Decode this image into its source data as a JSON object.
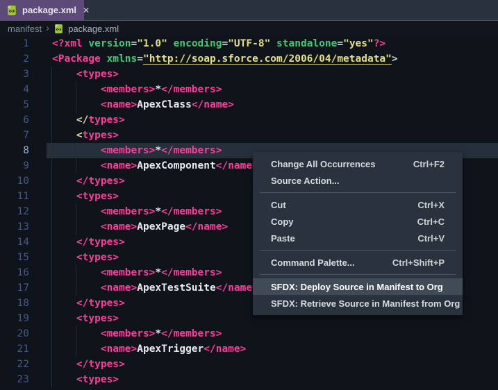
{
  "tab_bar": {
    "active_tab": {
      "label": "package.xml",
      "close_glyph": "✕"
    }
  },
  "breadcrumb": {
    "items": [
      "manifest",
      "package.xml"
    ],
    "separator": "›"
  },
  "editor": {
    "language": "xml",
    "active_line": 8,
    "lines": [
      {
        "n": 1,
        "tokens": [
          {
            "t": "tag",
            "s": "<?xml"
          },
          {
            "t": "plain",
            "s": " "
          },
          {
            "t": "attr",
            "s": "version"
          },
          {
            "t": "punc",
            "s": "="
          },
          {
            "t": "str",
            "s": "\"1.0\""
          },
          {
            "t": "plain",
            "s": " "
          },
          {
            "t": "attr",
            "s": "encoding"
          },
          {
            "t": "punc",
            "s": "="
          },
          {
            "t": "str",
            "s": "\"UTF-8\""
          },
          {
            "t": "plain",
            "s": " "
          },
          {
            "t": "attr",
            "s": "standalone"
          },
          {
            "t": "punc",
            "s": "="
          },
          {
            "t": "str",
            "s": "\"yes\""
          },
          {
            "t": "tag",
            "s": "?>"
          }
        ]
      },
      {
        "n": 2,
        "tokens": [
          {
            "t": "tag",
            "s": "<Package"
          },
          {
            "t": "plain",
            "s": " "
          },
          {
            "t": "attr",
            "s": "xmlns"
          },
          {
            "t": "punc",
            "s": "="
          },
          {
            "t": "link",
            "s": "\"http://soap.sforce.com/2006/04/metadata\""
          },
          {
            "t": "punc",
            "s": ">"
          }
        ]
      },
      {
        "n": 3,
        "tokens": [
          {
            "t": "ws",
            "s": "    "
          },
          {
            "t": "tag",
            "s": "<types>"
          }
        ]
      },
      {
        "n": 4,
        "tokens": [
          {
            "t": "ws",
            "s": "        "
          },
          {
            "t": "tag",
            "s": "<members>"
          },
          {
            "t": "plain",
            "s": "*"
          },
          {
            "t": "tag",
            "s": "</members>"
          }
        ]
      },
      {
        "n": 5,
        "tokens": [
          {
            "t": "ws",
            "s": "        "
          },
          {
            "t": "tag",
            "s": "<name>"
          },
          {
            "t": "plain",
            "s": "ApexClass"
          },
          {
            "t": "tag",
            "s": "</name>"
          }
        ]
      },
      {
        "n": 6,
        "tokens": [
          {
            "t": "ws",
            "s": "    "
          },
          {
            "t": "gold",
            "s": "</"
          },
          {
            "t": "tag",
            "s": "types>"
          }
        ]
      },
      {
        "n": 7,
        "tokens": [
          {
            "t": "ws",
            "s": "    "
          },
          {
            "t": "gold",
            "s": "<"
          },
          {
            "t": "tag",
            "s": "types>"
          }
        ]
      },
      {
        "n": 8,
        "tokens": [
          {
            "t": "ws",
            "s": "        "
          },
          {
            "t": "tag",
            "s": "<members>"
          },
          {
            "t": "plain",
            "s": "*"
          },
          {
            "t": "tag",
            "s": "</members>"
          }
        ]
      },
      {
        "n": 9,
        "tokens": [
          {
            "t": "ws",
            "s": "        "
          },
          {
            "t": "tag",
            "s": "<name>"
          },
          {
            "t": "plain",
            "s": "ApexComponent"
          },
          {
            "t": "tag",
            "s": "</name>"
          }
        ]
      },
      {
        "n": 10,
        "tokens": [
          {
            "t": "ws",
            "s": "    "
          },
          {
            "t": "tag",
            "s": "</types>"
          }
        ]
      },
      {
        "n": 11,
        "tokens": [
          {
            "t": "ws",
            "s": "    "
          },
          {
            "t": "tag",
            "s": "<types>"
          }
        ]
      },
      {
        "n": 12,
        "tokens": [
          {
            "t": "ws",
            "s": "        "
          },
          {
            "t": "tag",
            "s": "<members>"
          },
          {
            "t": "plain",
            "s": "*"
          },
          {
            "t": "tag",
            "s": "</members>"
          }
        ]
      },
      {
        "n": 13,
        "tokens": [
          {
            "t": "ws",
            "s": "        "
          },
          {
            "t": "tag",
            "s": "<name>"
          },
          {
            "t": "plain",
            "s": "ApexPage"
          },
          {
            "t": "tag",
            "s": "</name>"
          }
        ]
      },
      {
        "n": 14,
        "tokens": [
          {
            "t": "ws",
            "s": "    "
          },
          {
            "t": "tag",
            "s": "</types>"
          }
        ]
      },
      {
        "n": 15,
        "tokens": [
          {
            "t": "ws",
            "s": "    "
          },
          {
            "t": "tag",
            "s": "<types>"
          }
        ]
      },
      {
        "n": 16,
        "tokens": [
          {
            "t": "ws",
            "s": "        "
          },
          {
            "t": "tag",
            "s": "<members>"
          },
          {
            "t": "plain",
            "s": "*"
          },
          {
            "t": "tag",
            "s": "</members>"
          }
        ]
      },
      {
        "n": 17,
        "tokens": [
          {
            "t": "ws",
            "s": "        "
          },
          {
            "t": "tag",
            "s": "<name>"
          },
          {
            "t": "plain",
            "s": "ApexTestSuite"
          },
          {
            "t": "tag",
            "s": "</name>"
          }
        ]
      },
      {
        "n": 18,
        "tokens": [
          {
            "t": "ws",
            "s": "    "
          },
          {
            "t": "tag",
            "s": "</types>"
          }
        ]
      },
      {
        "n": 19,
        "tokens": [
          {
            "t": "ws",
            "s": "    "
          },
          {
            "t": "tag",
            "s": "<types>"
          }
        ]
      },
      {
        "n": 20,
        "tokens": [
          {
            "t": "ws",
            "s": "        "
          },
          {
            "t": "tag",
            "s": "<members>"
          },
          {
            "t": "plain",
            "s": "*"
          },
          {
            "t": "tag",
            "s": "</members>"
          }
        ]
      },
      {
        "n": 21,
        "tokens": [
          {
            "t": "ws",
            "s": "        "
          },
          {
            "t": "tag",
            "s": "<name>"
          },
          {
            "t": "plain",
            "s": "ApexTrigger"
          },
          {
            "t": "tag",
            "s": "</name>"
          }
        ]
      },
      {
        "n": 22,
        "tokens": [
          {
            "t": "ws",
            "s": "    "
          },
          {
            "t": "tag",
            "s": "</types>"
          }
        ]
      },
      {
        "n": 23,
        "tokens": [
          {
            "t": "ws",
            "s": "    "
          },
          {
            "t": "tag",
            "s": "<types>"
          }
        ]
      }
    ]
  },
  "context_menu": {
    "items": [
      {
        "type": "item",
        "label": "Change All Occurrences",
        "shortcut": "Ctrl+F2"
      },
      {
        "type": "item",
        "label": "Source Action...",
        "shortcut": ""
      },
      {
        "type": "separator"
      },
      {
        "type": "item",
        "label": "Cut",
        "shortcut": "Ctrl+X"
      },
      {
        "type": "item",
        "label": "Copy",
        "shortcut": "Ctrl+C"
      },
      {
        "type": "item",
        "label": "Paste",
        "shortcut": "Ctrl+V"
      },
      {
        "type": "separator"
      },
      {
        "type": "item",
        "label": "Command Palette...",
        "shortcut": "Ctrl+Shift+P"
      },
      {
        "type": "separator"
      },
      {
        "type": "item",
        "label": "SFDX: Deploy Source in Manifest to Org",
        "shortcut": "",
        "highlighted": true
      },
      {
        "type": "item",
        "label": "SFDX: Retrieve Source in Manifest from Org",
        "shortcut": ""
      }
    ]
  },
  "colors": {
    "active_tab_purple": "#5d4a79",
    "tab_bar_bg": "#28313d",
    "editor_bg": "#0f141b",
    "active_line_bg": "#26303b",
    "tag_pink": "#fb3d9c",
    "attribute_green": "#43c878",
    "string_yellow": "#e6e083",
    "line_number_blue": "#46578a",
    "menu_bg": "#2a323d",
    "menu_highlight": "#414b58",
    "file_icon_green": "#9ec433"
  }
}
